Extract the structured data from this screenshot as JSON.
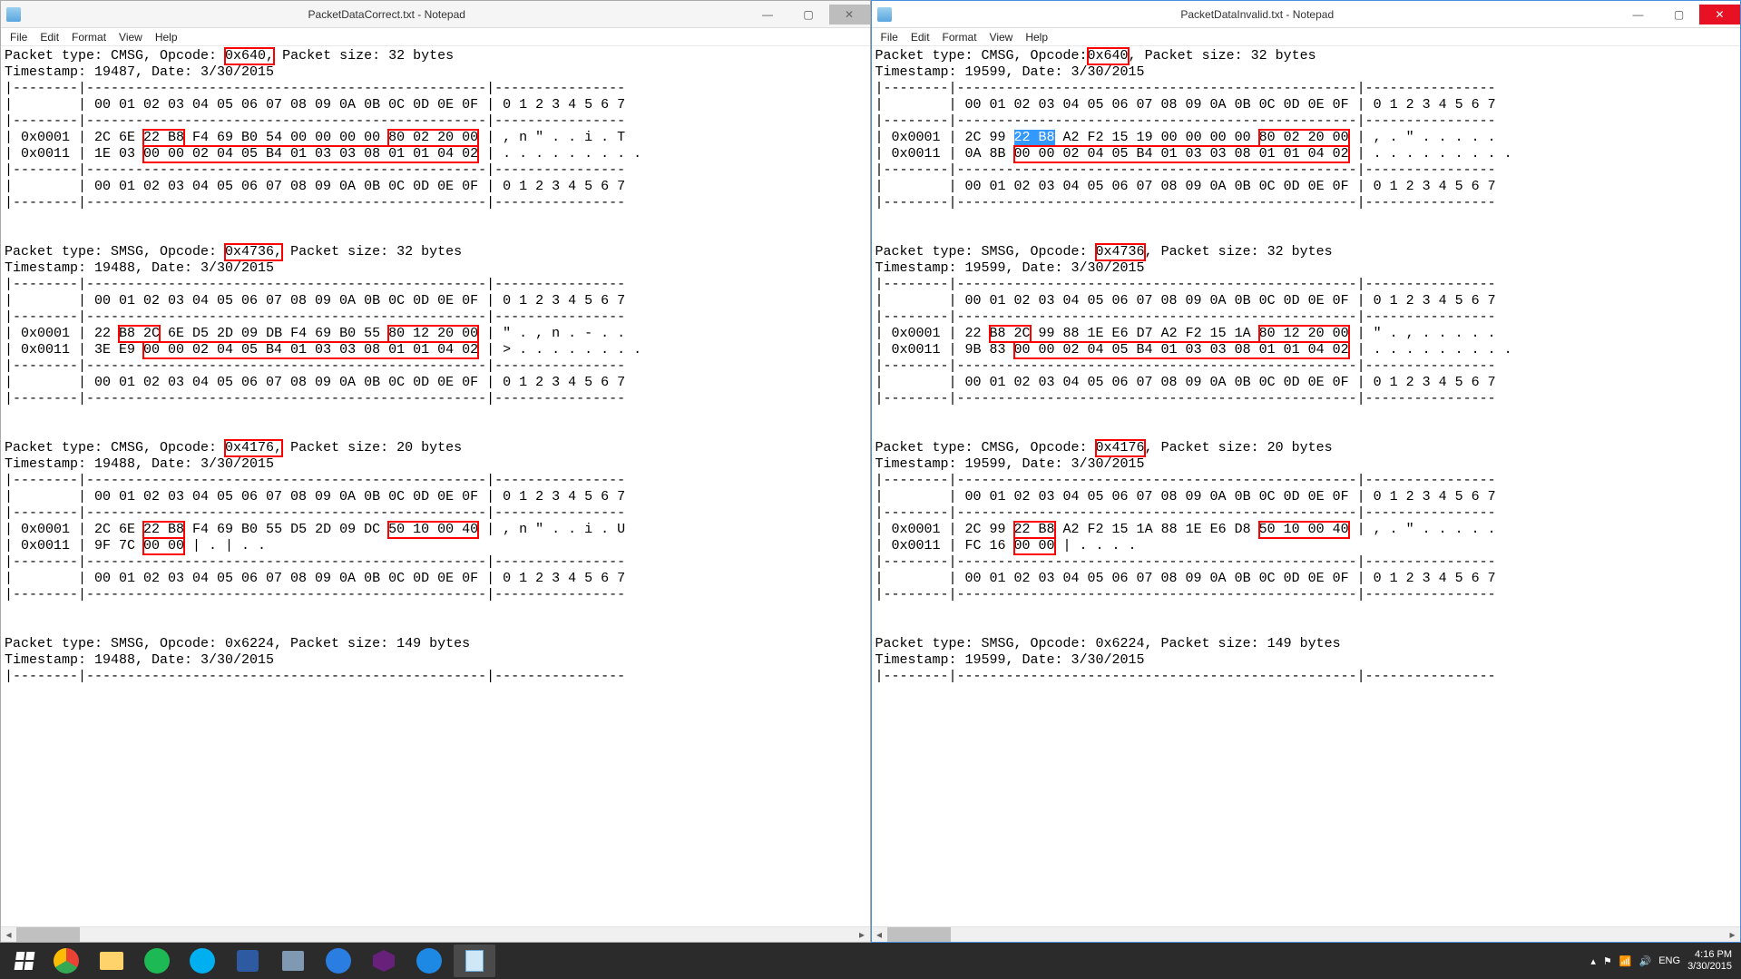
{
  "windows": [
    {
      "id": "left",
      "title": "PacketDataCorrect.txt - Notepad",
      "inactive": true,
      "menu": [
        "File",
        "Edit",
        "Format",
        "View",
        "Help"
      ],
      "packets": [
        {
          "header1_a": "Packet type: CMSG, Opcode: ",
          "opcode": "0x640,",
          "opcodeRed": true,
          "header1_b": " Packet size: 32 bytes",
          "header2": "Timestamp: 19487, Date: 3/30/2015",
          "rows": [
            {
              "addr": "0x0001",
              "pre": "2C 6E ",
              "red1": "22 B8",
              "mid": " F4 69 B0 54 00 00 00 00 ",
              "red2": "80 02 20 00",
              "post": "",
              "ascii": ", n \" . . i . T"
            },
            {
              "addr": "0x0011",
              "pre": "1E 03 ",
              "red1": "00 00 02 04 05 B4 01 03 03 08 01 01 04 02",
              "mid": "",
              "red2": "",
              "post": "",
              "ascii": ". . . . . . . . ."
            }
          ]
        },
        {
          "header1_a": "Packet type: SMSG, Opcode: ",
          "opcode": "0x4736,",
          "opcodeRed": true,
          "header1_b": " Packet size: 32 bytes",
          "header2": "Timestamp: 19488, Date: 3/30/2015",
          "rows": [
            {
              "addr": "0x0001",
              "pre": "22 ",
              "red1": "B8 2C",
              "mid": " 6E D5 2D 09 DB F4 69 B0 55 ",
              "red2": "80 12 20 00",
              "post": "",
              "ascii": "\" . , n . - . ."
            },
            {
              "addr": "0x0011",
              "pre": "3E E9 ",
              "red1": "00 00 02 04 05 B4 01 03 03 08 01 01 04 02",
              "mid": "",
              "red2": "",
              "post": "",
              "ascii": "> . . . . . . . ."
            }
          ]
        },
        {
          "header1_a": "Packet type: CMSG, Opcode: ",
          "opcode": "0x4176,",
          "opcodeRed": true,
          "header1_b": " Packet size: 20 bytes",
          "header2": "Timestamp: 19488, Date: 3/30/2015",
          "rows": [
            {
              "addr": "0x0001",
              "pre": "2C 6E ",
              "red1": "22 B8",
              "mid": " F4 69 B0 55 D5 2D 09 DC ",
              "red2": "50 10 00 40",
              "post": "",
              "ascii": ", n \" . . i . U"
            },
            {
              "addr": "0x0011",
              "pre": "9F 7C ",
              "red1": "00 00",
              "mid": "",
              "red2": "",
              "post": "",
              "ascii": ". | . ."
            }
          ]
        },
        {
          "header1_a": "Packet type: SMSG, Opcode: 0x6224, Packet size: 149 bytes",
          "opcode": "",
          "opcodeRed": false,
          "header1_b": "",
          "header2": "Timestamp: 19488, Date: 3/30/2015",
          "rows": []
        }
      ]
    },
    {
      "id": "right",
      "title": "PacketDataInvalid.txt - Notepad",
      "inactive": false,
      "menu": [
        "File",
        "Edit",
        "Format",
        "View",
        "Help"
      ],
      "packets": [
        {
          "header1_a": "Packet type: CMSG, Opcode:",
          "opcode": "0x640",
          "opcodeRed": true,
          "header1_b": ", Packet size: 32 bytes",
          "header2": "Timestamp: 19599, Date: 3/30/2015",
          "rows": [
            {
              "addr": "0x0001",
              "pre": "2C 99 ",
              "sel": "22 B8",
              "mid": " A2 F2 15 19 00 00 00 00 ",
              "red2": "80 02 20 00",
              "post": "",
              "ascii": ", . \" . . . . ."
            },
            {
              "addr": "0x0011",
              "pre": "0A 8B ",
              "red1": "00 00 02 04 05 B4 01 03 03 08 01 01 04 02",
              "mid": "",
              "red2": "",
              "post": "",
              "ascii": ". . . . . . . . ."
            }
          ]
        },
        {
          "header1_a": "Packet type: SMSG, Opcode: ",
          "opcode": "0x4736",
          "opcodeRed": true,
          "header1_b": ", Packet size: 32 bytes",
          "header2": "Timestamp: 19599, Date: 3/30/2015",
          "rows": [
            {
              "addr": "0x0001",
              "pre": "22 ",
              "red1": "B8 2C",
              "mid": " 99 88 1E E6 D7 A2 F2 15 1A ",
              "red2": "80 12 20 00",
              "post": "",
              "ascii": "\" . , . . . . ."
            },
            {
              "addr": "0x0011",
              "pre": "9B 83 ",
              "red1": "00 00 02 04 05 B4 01 03 03 08 01 01 04 02",
              "mid": "",
              "red2": "",
              "post": "",
              "ascii": ". . . . . . . . ."
            }
          ]
        },
        {
          "header1_a": "Packet type: CMSG, Opcode: ",
          "opcode": "0x4176",
          "opcodeRed": true,
          "header1_b": ", Packet size: 20 bytes",
          "header2": "Timestamp: 19599, Date: 3/30/2015",
          "rows": [
            {
              "addr": "0x0001",
              "pre": "2C 99 ",
              "red1": "22 B8",
              "mid": " A2 F2 15 1A 88 1E E6 D8 ",
              "red2": "50 10 00 40",
              "post": "",
              "ascii": ", . \" . . . . ."
            },
            {
              "addr": "0x0011",
              "pre": "FC 16 ",
              "red1": "00 00",
              "mid": "",
              "red2": "",
              "post": "",
              "ascii": ". . . ."
            }
          ]
        },
        {
          "header1_a": "Packet type: SMSG, Opcode: 0x6224, Packet size: 149 bytes",
          "opcode": "",
          "opcodeRed": false,
          "header1_b": "",
          "header2": "Timestamp: 19599, Date: 3/30/2015",
          "rows": []
        }
      ]
    }
  ],
  "hexHeader": "00 01 02 03 04 05 06 07 08 09 0A 0B 0C 0D 0E 0F",
  "asciiHeader": "0 1 2 3 4 5 6 7",
  "dashTop": "|--------|-------------------------------------------------|----------------",
  "dashMid": "|--------|-------------------------------------------------|----------------",
  "taskbar": {
    "tray": {
      "lang": "ENG",
      "time": "4:16 PM",
      "date": "3/30/2015"
    }
  }
}
